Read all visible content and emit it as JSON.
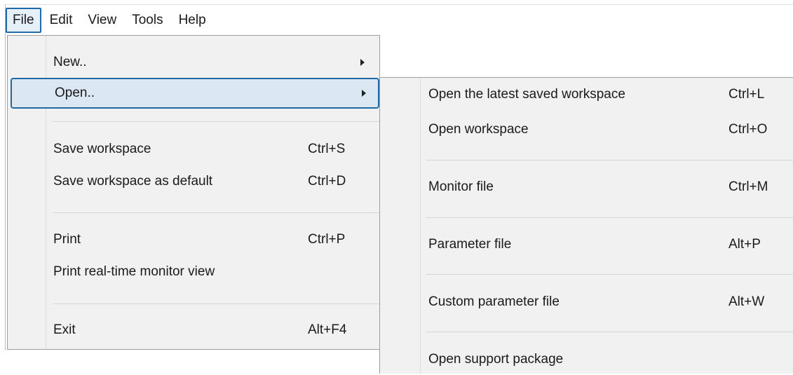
{
  "menubar": {
    "items": [
      {
        "label": "File"
      },
      {
        "label": "Edit"
      },
      {
        "label": "View"
      },
      {
        "label": "Tools"
      },
      {
        "label": "Help"
      }
    ]
  },
  "file_menu": {
    "new": {
      "label": "New.."
    },
    "open": {
      "label": "Open.."
    },
    "save_workspace": {
      "label": "Save workspace",
      "shortcut": "Ctrl+S"
    },
    "save_default": {
      "label": "Save workspace as default",
      "shortcut": "Ctrl+D"
    },
    "print": {
      "label": "Print",
      "shortcut": "Ctrl+P"
    },
    "print_monitor": {
      "label": "Print real-time monitor view"
    },
    "exit": {
      "label": "Exit",
      "shortcut": "Alt+F4"
    }
  },
  "open_submenu": {
    "latest": {
      "label": "Open the latest saved workspace",
      "shortcut": "Ctrl+L"
    },
    "workspace": {
      "label": "Open workspace",
      "shortcut": "Ctrl+O"
    },
    "monitor": {
      "label": "Monitor file",
      "shortcut": "Ctrl+M"
    },
    "parameter": {
      "label": "Parameter file",
      "shortcut": "Alt+P"
    },
    "custom_parameter": {
      "label": "Custom parameter file",
      "shortcut": "Alt+W"
    },
    "support": {
      "label": "Open support package"
    }
  },
  "colors": {
    "accent": "#1f6aa6",
    "menu_bg": "#f1f1f1",
    "hover_bg": "#dbe7f2"
  }
}
